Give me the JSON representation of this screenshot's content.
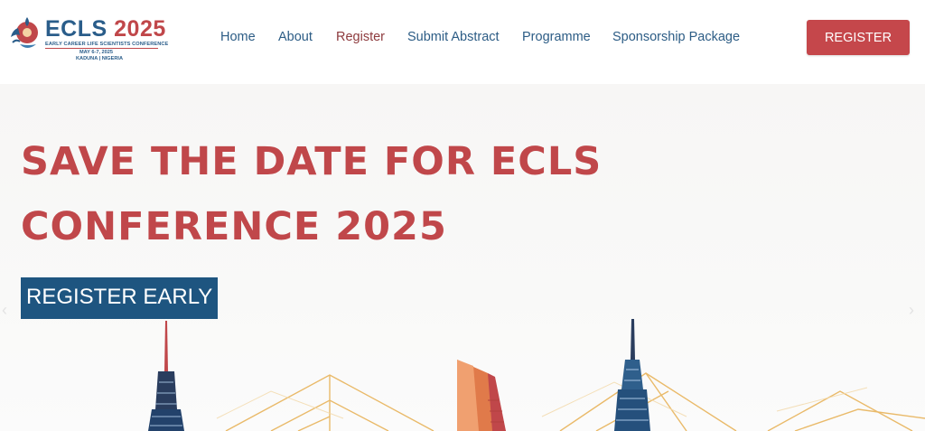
{
  "header": {
    "logo": {
      "title_part1": "ECLS",
      "title_part2": "2025",
      "subtitle": "EARLY CAREER LIFE SCIENTISTS CONFERENCE",
      "date": "MAY 6-7, 2025",
      "location": "KADUNA | NIGERIA"
    },
    "nav": [
      {
        "label": "Home"
      },
      {
        "label": "About"
      },
      {
        "label": "Register"
      },
      {
        "label": "Submit Abstract"
      },
      {
        "label": "Programme"
      },
      {
        "label": "Sponsorship Package"
      }
    ],
    "register_button": "REGISTER"
  },
  "hero": {
    "title_line1": "SAVE THE DATE FOR ECLS",
    "title_line2": "CONFERENCE 2025",
    "button": "REGISTER EARLY",
    "prev_arrow": "‹",
    "next_arrow": "›"
  },
  "colors": {
    "accent_red": "#c5474b",
    "brand_blue": "#1e5580",
    "nav_text": "#2c5c85"
  }
}
